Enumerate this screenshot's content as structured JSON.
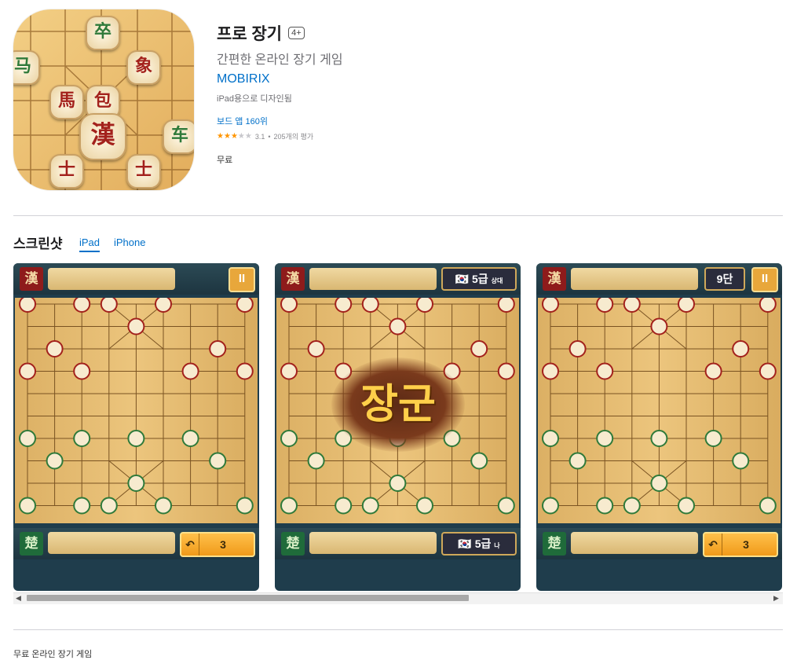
{
  "app": {
    "title": "프로 장기",
    "age_rating": "4+",
    "subtitle": "간편한 온라인 장기 게임",
    "developer": "MOBIRIX",
    "designed_for": "iPad용으로 디자인됨",
    "rank": "보드 앱 160위",
    "rating": {
      "value": "3.1",
      "count_text": "205개의 평가",
      "stars_filled": 3,
      "stars_total": 5
    },
    "price": "무료",
    "icon_pieces": [
      "卒",
      "象",
      "馬",
      "包",
      "漢",
      "车",
      "士",
      "士",
      "马"
    ]
  },
  "screenshots": {
    "section_title": "스크린샷",
    "tabs": [
      {
        "label": "iPad",
        "selected": true
      },
      {
        "label": "iPhone",
        "selected": false
      }
    ],
    "items": [
      {
        "han_label": "漢",
        "cho_label": "楚",
        "undo_count": "3",
        "pause": "II"
      },
      {
        "han_label": "漢",
        "cho_label": "楚",
        "overlay_text": "장군",
        "top_level": "5급",
        "top_caption": "상대",
        "bottom_level": "5급",
        "bottom_caption": "나"
      },
      {
        "han_label": "漢",
        "cho_label": "楚",
        "undo_count": "3",
        "pause": "II",
        "top_level": "9단"
      }
    ]
  },
  "description": "무료 온라인 장기 게임",
  "colors": {
    "link": "#0070c9",
    "star": "#ff9500",
    "han": "#a3211c",
    "cho": "#2f7a3a"
  }
}
